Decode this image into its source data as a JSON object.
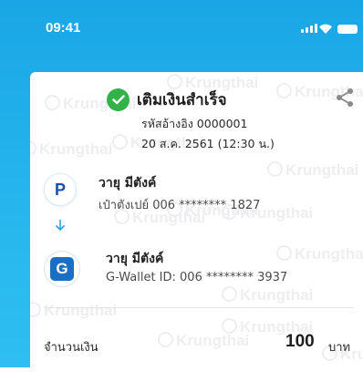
{
  "status_bar": {
    "time": "09:41"
  },
  "receipt": {
    "title": "เติมเงินสำเร็จ",
    "reference": "รหัสอ้างอิง 0000001",
    "datetime": "20 ส.ค. 2561 (12:30 น.)"
  },
  "from": {
    "logo_letter": "P",
    "name": "วายุ มีตังค์",
    "account": "เป๋าตังเปย์ 006 ******** 1827"
  },
  "to": {
    "logo_letter": "G",
    "name": "วายุ มีตังค์",
    "account": "G-Wallet ID: 006 ******** 3937"
  },
  "amount": {
    "label": "จำนวนเงิน",
    "value": "100",
    "unit": "บาท"
  },
  "watermark": {
    "text": "Krungthai"
  },
  "colors": {
    "header_blue": "#1aa6e6",
    "success_green": "#34b24a",
    "accent_blue": "#2aa3e4",
    "gwallet_blue": "#1b6fc2"
  }
}
